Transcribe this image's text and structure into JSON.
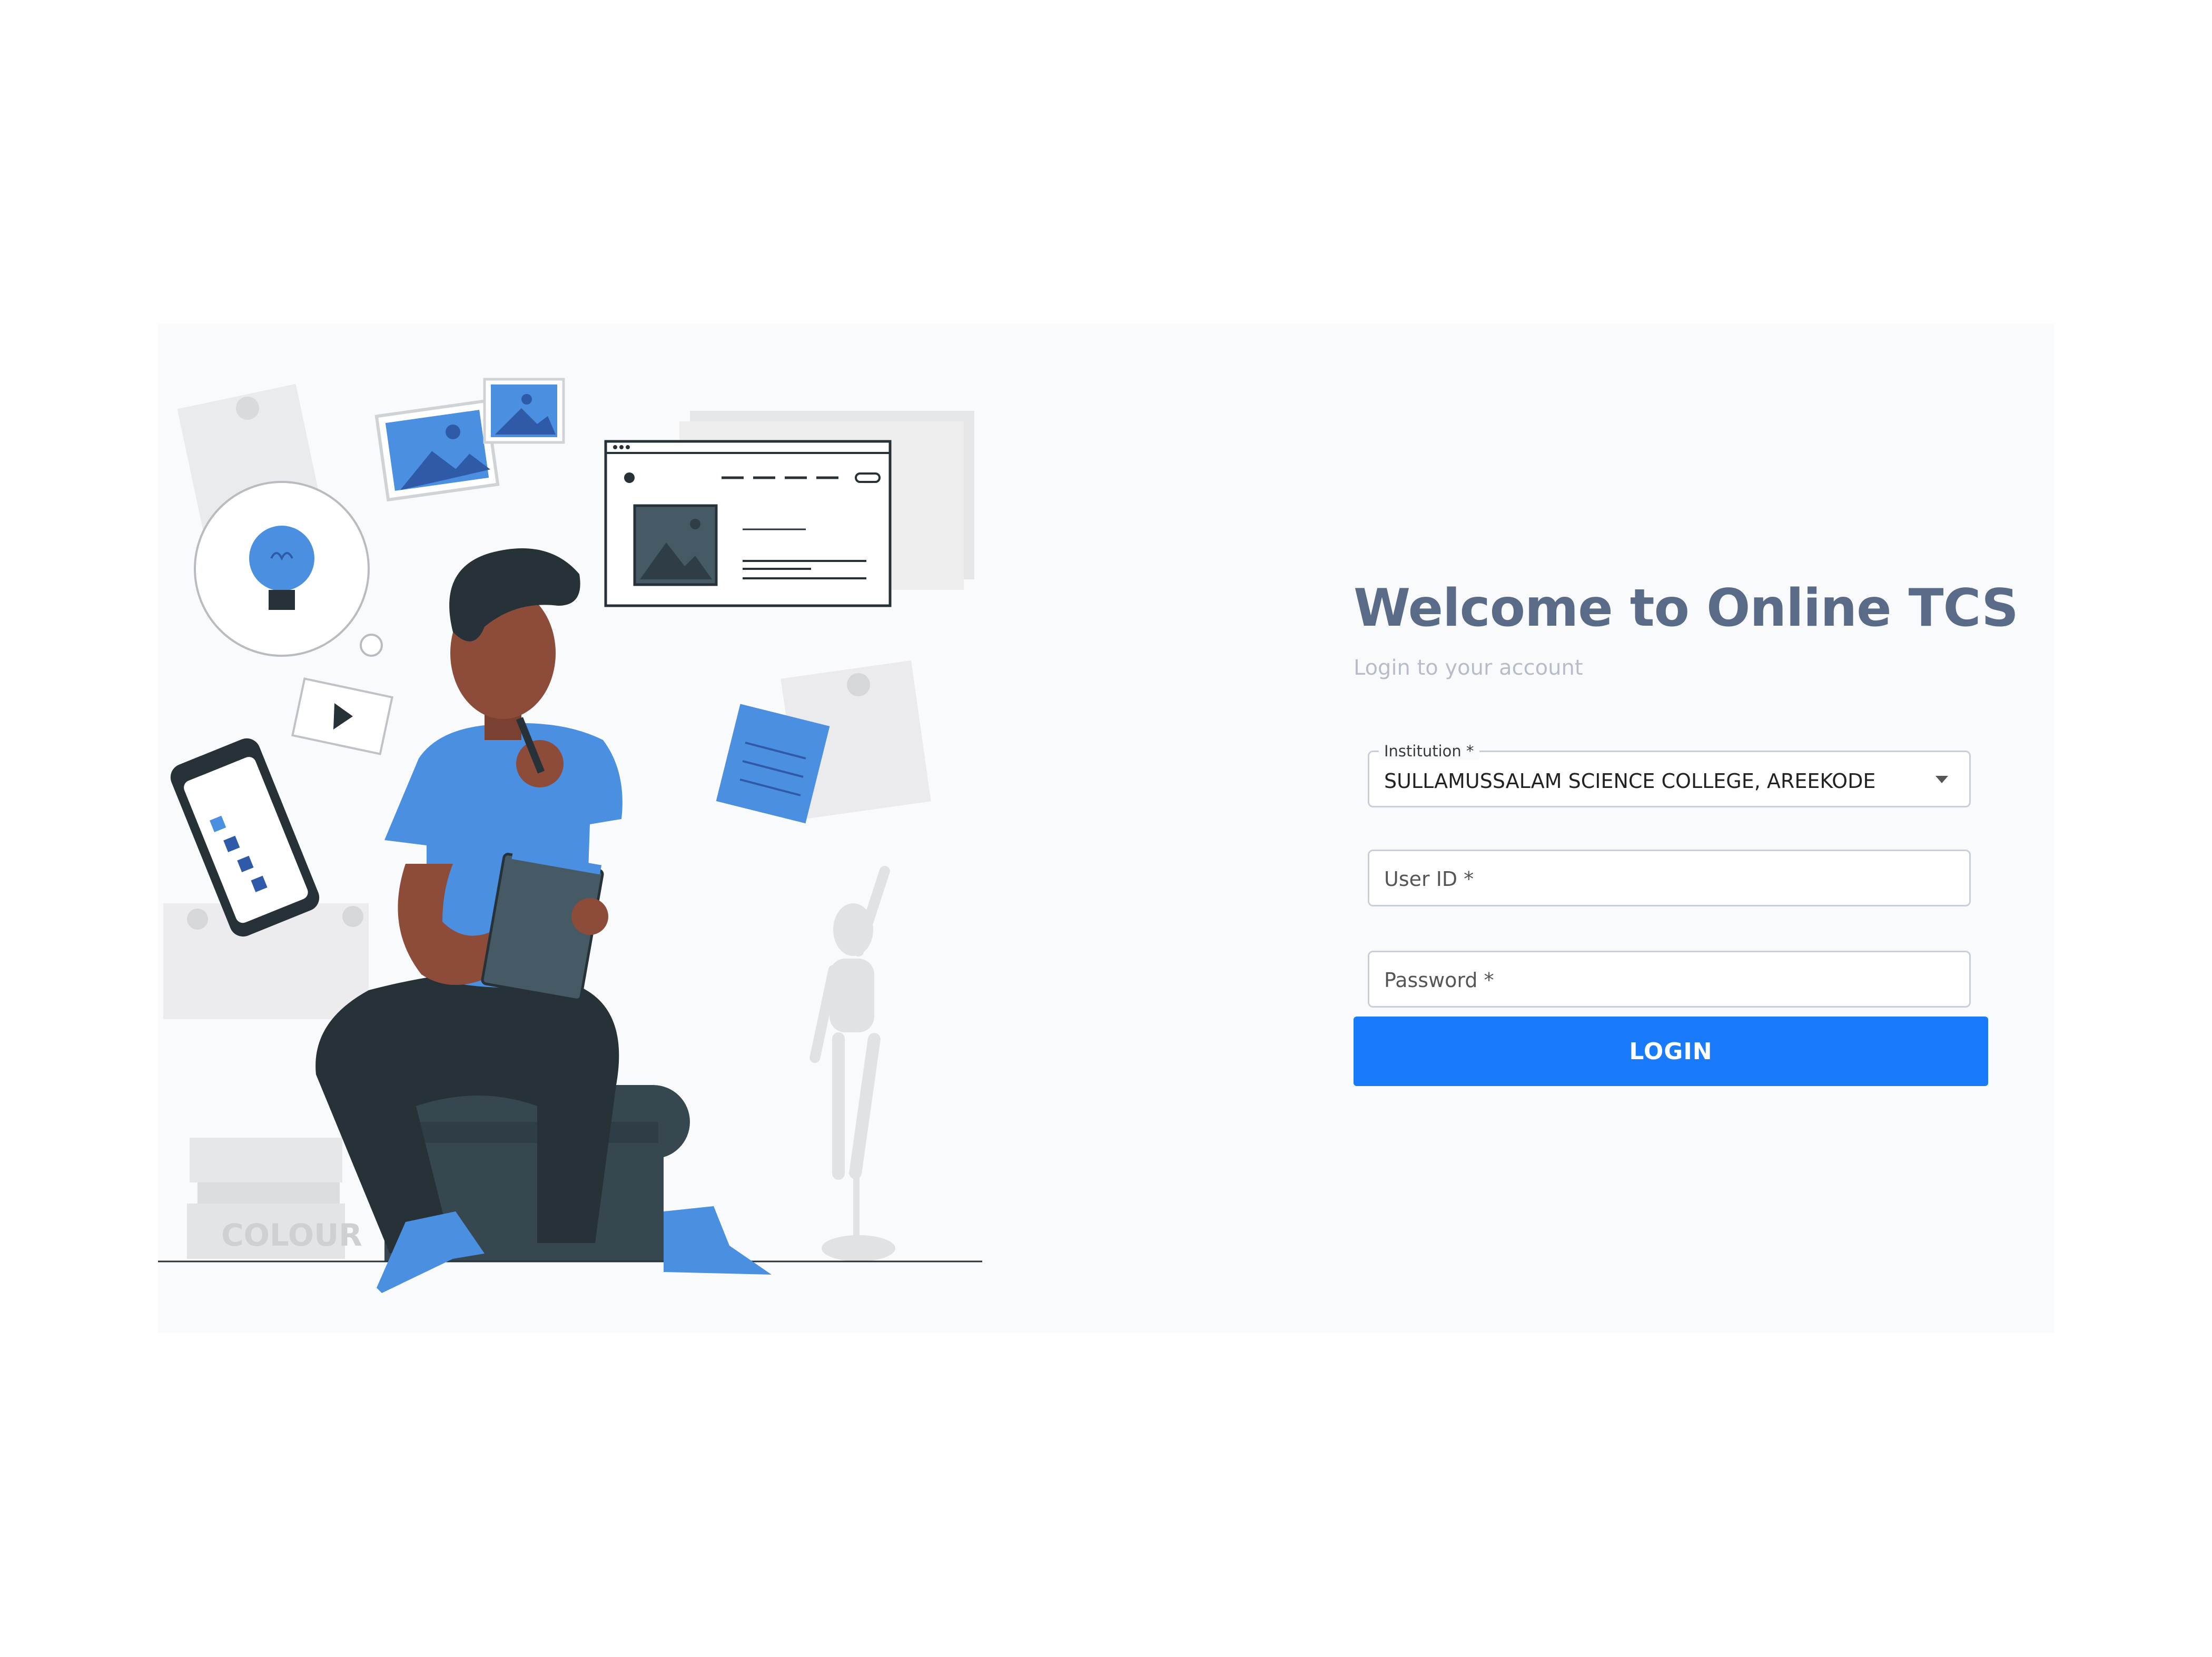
{
  "page": {
    "title": "Welcome to Online TCS",
    "subtitle": "Login to your account"
  },
  "form": {
    "institution": {
      "label": "Institution *",
      "value": "SULLAMUSSALAM SCIENCE COLLEGE, AREEKODE"
    },
    "user_id": {
      "placeholder": "User ID *"
    },
    "password": {
      "placeholder": "Password *"
    },
    "login_label": "LOGIN"
  },
  "illustration": {
    "books_label": "COLOUR"
  },
  "colors": {
    "accent": "#1a7afc",
    "title": "#596b87",
    "illustration_blue": "#4a8fe0",
    "dark": "#263238"
  }
}
